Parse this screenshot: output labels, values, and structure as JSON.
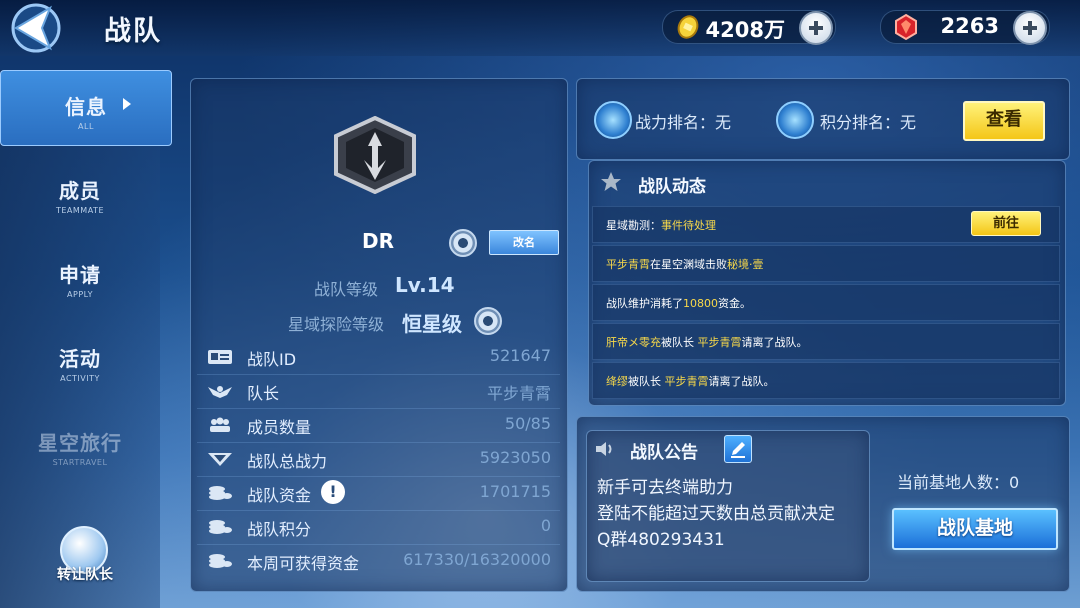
{
  "header": {
    "title": "战队",
    "gold_amount": "4208万",
    "gem_amount": "2263"
  },
  "sidebar": {
    "items": [
      {
        "label": "信息",
        "sub": "ALL"
      },
      {
        "label": "成员",
        "sub": "TEAMMATE"
      },
      {
        "label": "申请",
        "sub": "APPLY"
      },
      {
        "label": "活动",
        "sub": "ACTIVITY"
      },
      {
        "label": "星空旅行",
        "sub": "STARTRAVEL"
      }
    ],
    "transfer_label": "转让队长"
  },
  "team": {
    "name": "DR",
    "rename_label": "改名",
    "level_label": "战队等级",
    "level_value": "Lv.14",
    "explore_label": "星域探险等级",
    "explore_value": "恒星级",
    "stats": [
      {
        "key": "战队ID",
        "value": "521647"
      },
      {
        "key": "队长",
        "value": "平步青霄"
      },
      {
        "key": "成员数量",
        "value": "50/85"
      },
      {
        "key": "战队总战力",
        "value": "5923050"
      },
      {
        "key": "战队资金",
        "value": "1701715"
      },
      {
        "key": "战队积分",
        "value": "0"
      },
      {
        "key": "本周可获得资金",
        "value": "617330/16320000"
      }
    ]
  },
  "ranking": {
    "power_rank": "战力排名：无",
    "score_rank": "积分排名：无",
    "view_label": "查看"
  },
  "dynamics": {
    "title": "战队动态",
    "go_label": "前往",
    "rows": [
      {
        "p1": "星域勘测：",
        "p2": "事件待处理",
        "p3": "",
        "p4": "",
        "p5": ""
      },
      {
        "p1": "",
        "p2": "平步青霄",
        "p3": "在星空渊域击败",
        "p4": "秘境·壹",
        "p5": ""
      },
      {
        "p1": "战队维护消耗了",
        "p2": "10800",
        "p3": "资金。",
        "p4": "",
        "p5": ""
      },
      {
        "p1": "",
        "p2": "肝帝メ零充",
        "p3": "被队长 ",
        "p4": "平步青霄",
        "p5": "请离了战队。"
      },
      {
        "p1": "",
        "p2": "绛缪",
        "p3": "被队长 ",
        "p4": "平步青霄",
        "p5": "请离了战队。"
      }
    ]
  },
  "announcement": {
    "title": "战队公告",
    "lines": [
      "新手可去终端助力",
      "登陆不能超过天数由总贡献决定",
      "Q群480293431"
    ]
  },
  "base": {
    "count_text": "当前基地人数：0",
    "button_label": "战队基地"
  },
  "colors": {
    "accent": "#f7d84a",
    "active_tab": "#3f8fe0"
  }
}
